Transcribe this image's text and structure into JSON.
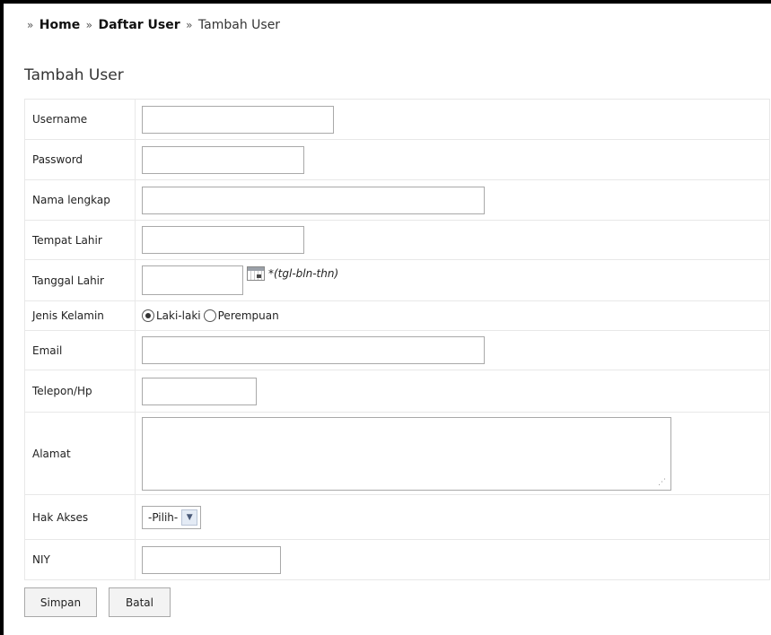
{
  "breadcrumb": {
    "home": "Home",
    "users": "Daftar User",
    "current": "Tambah User",
    "separator": "»"
  },
  "page_title": "Tambah User",
  "form": {
    "username_label": "Username",
    "username_value": "",
    "password_label": "Password",
    "password_value": "",
    "fullname_label": "Nama lengkap",
    "fullname_value": "",
    "birthplace_label": "Tempat Lahir",
    "birthplace_value": "",
    "birthdate_label": "Tanggal Lahir",
    "birthdate_value": "",
    "birthdate_hint": "*(tgl-bln-thn)",
    "gender_label": "Jenis Kelamin",
    "gender_options": [
      "Laki-laki",
      "Perempuan"
    ],
    "gender_selected": "Laki-laki",
    "email_label": "Email",
    "email_value": "",
    "phone_label": "Telepon/Hp",
    "phone_value": "",
    "address_label": "Alamat",
    "address_value": "",
    "access_label": "Hak Akses",
    "access_selected": "-Pilih-",
    "niy_label": "NIY",
    "niy_value": ""
  },
  "buttons": {
    "save": "Simpan",
    "cancel": "Batal"
  },
  "icons": {
    "calendar": "calendar-icon",
    "dropdown": "chevron-down-icon"
  }
}
